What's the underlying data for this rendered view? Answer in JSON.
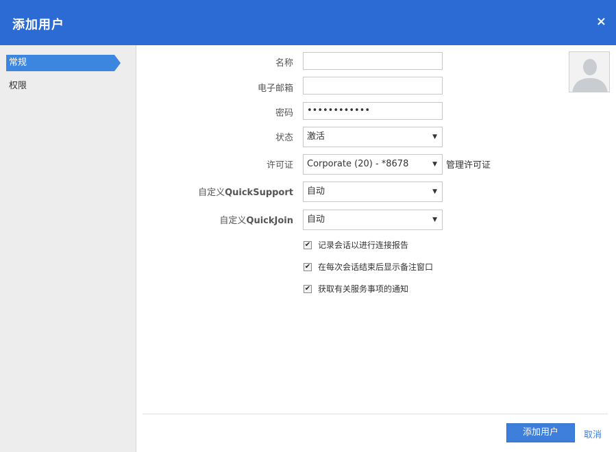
{
  "dialog": {
    "title": "添加用户",
    "close_glyph": "×"
  },
  "sidebar": {
    "items": [
      {
        "label": "常规",
        "active": true
      },
      {
        "label": "权限",
        "active": false
      }
    ]
  },
  "form": {
    "name": {
      "label": "名称",
      "value": ""
    },
    "email": {
      "label": "电子邮箱",
      "value": ""
    },
    "password": {
      "label": "密码",
      "value": "••••••••••••"
    },
    "status": {
      "label": "状态",
      "value": "激活"
    },
    "license": {
      "label": "许可证",
      "value": "Corporate (20) - *8678",
      "manage_link": "管理许可证"
    },
    "quicksupport": {
      "label_prefix": "自定义",
      "label_brand": "QuickSupport",
      "value": "自动"
    },
    "quickjoin": {
      "label_prefix": "自定义",
      "label_brand": "QuickJoin",
      "value": "自动"
    },
    "dropdown_arrow": "▼",
    "checkboxes": [
      {
        "label": "记录会话以进行连接报告",
        "checked": true
      },
      {
        "label": "在每次会话结束后显示备注窗口",
        "checked": true
      },
      {
        "label": "获取有关服务事项的通知",
        "checked": true
      }
    ],
    "check_glyph": "✔"
  },
  "footer": {
    "submit_label": "添加用户",
    "cancel_label": "取消"
  },
  "colors": {
    "header": "#2b6bd3",
    "accent": "#3d86e0",
    "primary_button": "#3d7fdb"
  },
  "icons": {
    "avatar": "user-avatar-placeholder-icon",
    "close": "close-icon",
    "dropdown": "chevron-down-icon",
    "checkbox": "checkmark-icon"
  }
}
